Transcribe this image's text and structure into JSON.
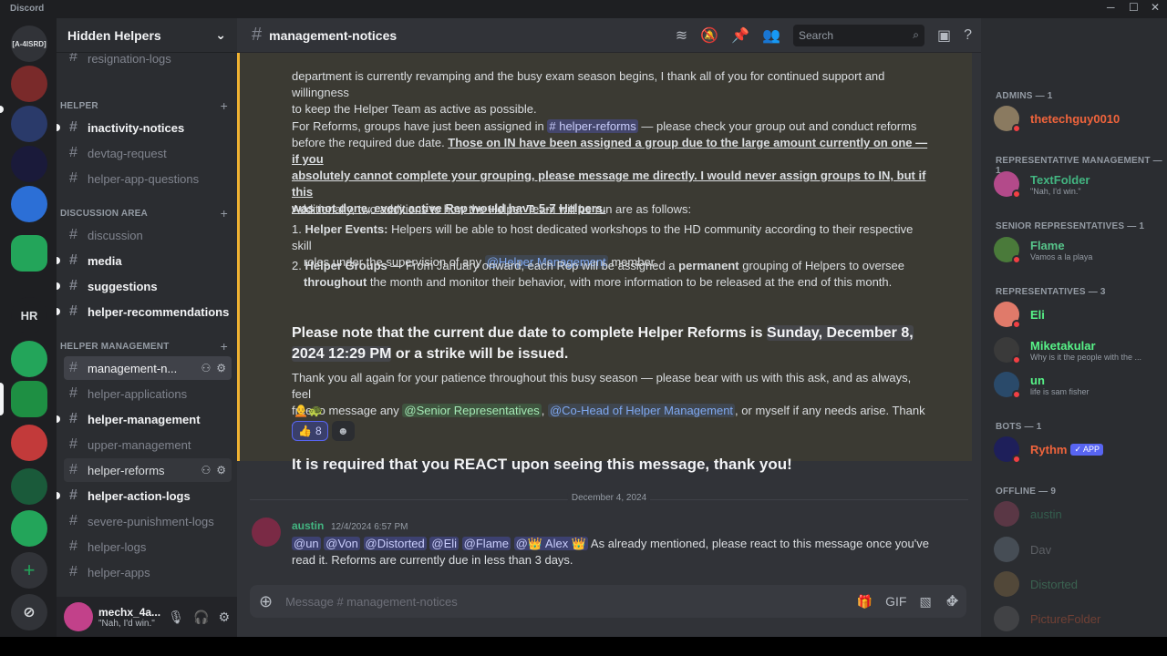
{
  "window": {
    "title": "Discord"
  },
  "rail": {
    "server_label_1": "[A-4ISRD]",
    "server_label_hr": "HR",
    "add_label": "+"
  },
  "sidebar": {
    "guild_name": "Hidden Helpers",
    "partial_channel": "resignation-logs",
    "categories": [
      "HELPER",
      "DISCUSSION AREA",
      "HELPER MANAGEMENT"
    ],
    "helper_channels": [
      "inactivity-notices",
      "devtag-request",
      "helper-app-questions"
    ],
    "discussion_channels": [
      "discussion",
      "media",
      "suggestions",
      "helper-recommendations"
    ],
    "management_channels": [
      "management-n...",
      "helper-applications",
      "helper-management",
      "upper-management",
      "helper-reforms",
      "helper-action-logs",
      "severe-punishment-logs",
      "helper-logs",
      "helper-apps"
    ]
  },
  "user_panel": {
    "name": "mechx_4a...",
    "status": "\"Nah, I'd win.\""
  },
  "header": {
    "channel_name": "management-notices",
    "search_placeholder": "Search"
  },
  "message": {
    "line1": "department is currently revamping and the busy exam season begins, I thank all of you for continued support and willingness",
    "line2": "to keep the Helper Team as active as possible.",
    "reforms_a": "For Reforms, groups have just been assigned in ",
    "reforms_mention": "# helper-reforms",
    "reforms_b": " — please check your group out and conduct reforms",
    "reforms_c": "before the required due date. ",
    "reforms_u1": "Those on IN have been assigned a group due to the large amount currently on one — if you",
    "reforms_u2": "absolutely cannot complete your grouping, please message me directly. I would never assign groups to IN, but if this",
    "reforms_u3": "was not done, every active Rep would have 5-7 Helpers.",
    "additions": "Additionally, two additions to how the Helper Team will be run are as follows:",
    "item1_num": "1.",
    "item1_title": "Helper Events:",
    "item1_text": " Helpers will be able to host dedicated workshops to the HD community according to their respective skill",
    "item1_text2": "roles under the supervision of any ",
    "item1_mention": "@Helper Management",
    "item1_text3": " member.",
    "item2_num": "2.",
    "item2_title": "Helper Groups",
    "item2_text": " — From January onward, each Rep will be assigned a ",
    "item2_bold": "permanent",
    "item2_text2": " grouping of Helpers to oversee",
    "item2_bold2": "throughout",
    "item2_text3": " the month and monitor their behavior, with more information to be released at the end of this month.",
    "notice_1": "Please note that the current due date to complete Helper Reforms is ",
    "notice_date": "Sunday, December 8,",
    "notice_date2": "2024 12:29 PM",
    "notice_2": " or a strike will be issued.",
    "thanks_1": "Thank you all again for your patience throughout this busy season — please bear with us with this ask, and as always, feel",
    "thanks_2a": "free to message any ",
    "thanks_m1": "@Senior Representatives",
    "thanks_comma": ", ",
    "thanks_m2": "@Co-Head of Helper Management",
    "thanks_2b": ", or myself if any needs arise. Thank you!",
    "reaction_count": "8",
    "required": "It is required that you REACT upon seeing this message, thank you!"
  },
  "divider_date": "December 4, 2024",
  "reply": {
    "author": "austin",
    "timestamp": "12/4/2024 6:57 PM",
    "mentions": [
      "@un",
      "@Von",
      "@Distorted",
      "@Eli",
      "@Flame",
      "@",
      "Alex"
    ],
    "text1": " As already mentioned, please react to this message once you've",
    "text2": "read it. Reforms are currently due in less than 3 days."
  },
  "composer": {
    "placeholder": "Message #  management-notices"
  },
  "members": {
    "groups": [
      "ADMINS — 1",
      "REPRESENTATIVE MANAGEMENT — 1",
      "SENIOR REPRESENTATIVES — 1",
      "REPRESENTATIVES — 3",
      "BOTS — 1",
      "OFFLINE — 9"
    ],
    "list": [
      {
        "name": "thetechguy0010",
        "sub": "",
        "color": "#f0643c"
      },
      {
        "name": "TextFolder",
        "sub": "\"Nah, I'd win.\"",
        "color": "#43b581"
      },
      {
        "name": "Flame",
        "sub": "Vamos a la playa",
        "color": "#57c48a"
      },
      {
        "name": "Eli",
        "sub": "",
        "color": "#57f287"
      },
      {
        "name": "Miketakular",
        "sub": "Why is it the people with the ...",
        "color": "#57f287"
      },
      {
        "name": "un",
        "sub": "life is sam fisher",
        "color": "#57f287"
      },
      {
        "name": "Rythm",
        "sub": "",
        "color": "#f0643c"
      },
      {
        "name": "austin",
        "sub": "",
        "color": "#43b581"
      },
      {
        "name": "Dav",
        "sub": "",
        "color": "#b5bac1"
      },
      {
        "name": "Distorted",
        "sub": "",
        "color": "#57c48a"
      },
      {
        "name": "PictureFolder",
        "sub": "",
        "color": "#f0643c"
      }
    ],
    "app_badge": "✓ APP"
  }
}
